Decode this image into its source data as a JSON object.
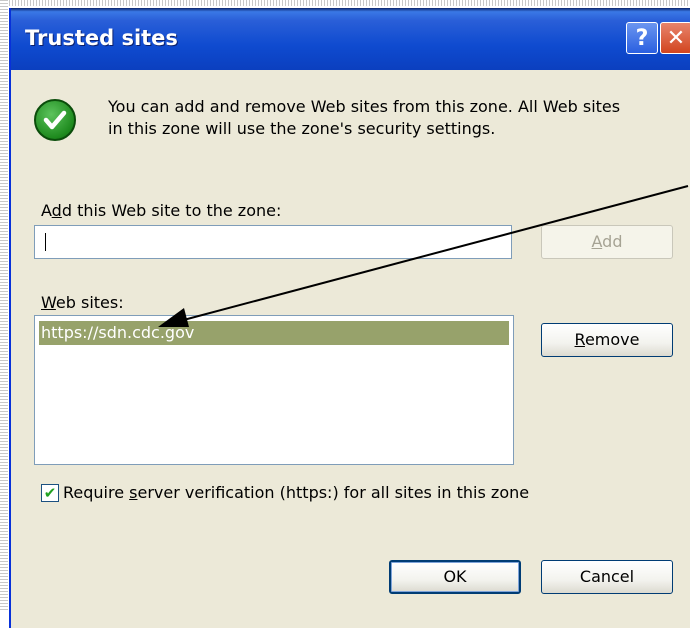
{
  "window": {
    "title": "Trusted sites"
  },
  "titlebar": {
    "help_glyph": "?",
    "close_glyph": "✕"
  },
  "info": {
    "icon": "green-check-circle-icon",
    "text_line1": "You can add and remove Web sites from this zone. All Web sites",
    "text_line2": "in this zone will use the zone's security settings."
  },
  "add_site": {
    "label_before": "A",
    "label_accel": "d",
    "label_after": "d this Web site to the zone:",
    "value": "",
    "button_accel": "A",
    "button_after": "dd"
  },
  "web_sites": {
    "label_accel": "W",
    "label_after": "eb sites:",
    "items": [
      "https://sdn.cdc.gov"
    ],
    "remove_accel": "R",
    "remove_after": "emove"
  },
  "verification": {
    "checked": true,
    "check_glyph": "✔",
    "label_before": "Require ",
    "label_accel": "s",
    "label_after": "erver verification (https:) for all sites in this zone"
  },
  "footer": {
    "ok_label": "OK",
    "cancel_label": "Cancel"
  },
  "colors": {
    "dialog_bg": "#ece9d8",
    "titlebar": "#0b4fd4",
    "selection": "#97a26b",
    "annotation_arrow": "#000000"
  }
}
